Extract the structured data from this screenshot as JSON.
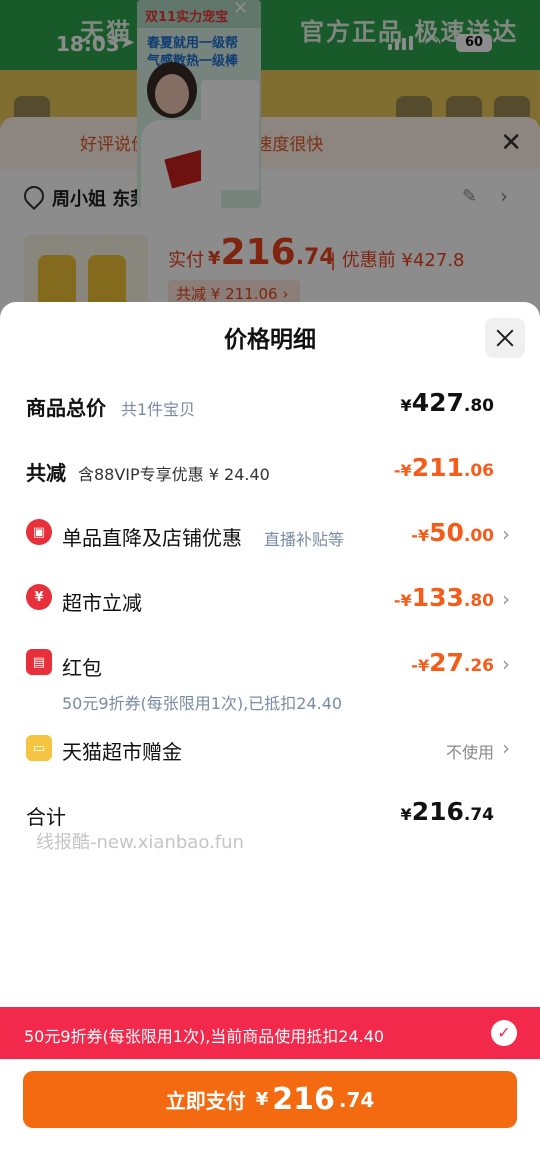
{
  "status_bar": {
    "time": "18:03",
    "battery": "60"
  },
  "background": {
    "banner_left": "天猫",
    "banner_right": "官方正品 极速送达",
    "notice_text": "好评说价格很便宜,送货速度很快",
    "address": "周小姐 东莞",
    "pay_label": "实付",
    "pay_symbol": "¥",
    "pay_int": "216",
    "pay_dec": ".74",
    "pay_before": "| 优惠前 ¥427.8",
    "save_tag": "共减 ¥ 211.06 ›"
  },
  "video": {
    "title": "双11实力宠宝",
    "line1": "春夏就用一级帮",
    "line2": "气感散热一级棒"
  },
  "sheet": {
    "title": "价格明细",
    "rows": [
      {
        "label": "商品总价",
        "sub": "共1件宝贝",
        "sym": "¥",
        "int": "427",
        "dec": ".80"
      },
      {
        "label": "共减",
        "sub": "含88VIP专享优惠 ¥ 24.40",
        "sym": "-¥",
        "int": "211",
        "dec": ".06"
      },
      {
        "label": "单品直降及店铺优惠",
        "sub": "直播补贴等",
        "sym": "-¥",
        "int": "50",
        "dec": ".00"
      },
      {
        "label": "超市立减",
        "sym": "-¥",
        "int": "133",
        "dec": ".80"
      },
      {
        "label": "红包",
        "sub": "50元9折券(每张限用1次),已抵扣24.40",
        "sym": "-¥",
        "int": "27",
        "dec": ".26"
      },
      {
        "label": "天猫超市赠金",
        "value": "不使用"
      },
      {
        "label": "合计",
        "sym": "¥",
        "int": "216",
        "dec": ".74"
      }
    ],
    "watermark": "线报酷-new.xianbao.fun"
  },
  "coupon_bar": {
    "text": "50元9折券(每张限用1次),当前商品使用抵扣24.40"
  },
  "pay_button": {
    "label": "立即支付",
    "sym": "¥",
    "int": "216",
    "dec": ".74"
  },
  "colors": {
    "accent_orange": "#f46a10",
    "discount_red": "#f35c19",
    "coupon_bar": "#f2294b"
  }
}
